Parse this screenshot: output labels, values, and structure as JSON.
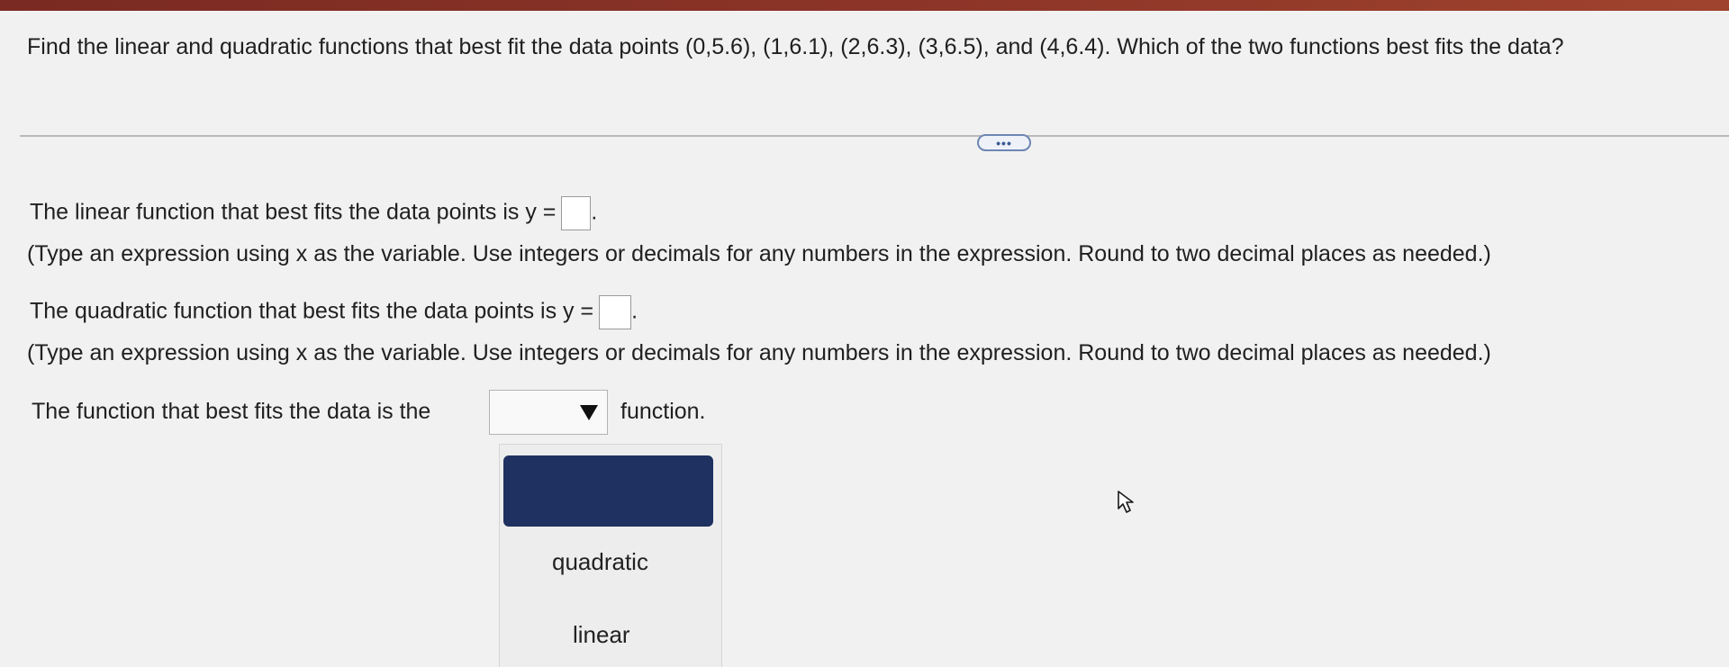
{
  "question": {
    "text": "Find the linear and quadratic functions that best fit the data points (0,5.6), (1,6.1), (2,6.3), (3,6.5), and (4,6.4). Which of the two functions best fits the data?"
  },
  "more_button": {
    "label": "•••"
  },
  "linear": {
    "prompt": "The linear function that best fits the data points is y =",
    "end": ".",
    "instruction": "(Type an expression using x as the variable. Use integers or decimals for any numbers in the expression. Round to two decimal places as needed.)",
    "value": ""
  },
  "quadratic": {
    "prompt": "The quadratic function that best fits the data points is y =",
    "end": ".",
    "instruction": "(Type an expression using x as the variable. Use integers or decimals for any numbers in the expression. Round to two decimal places as needed.)",
    "value": ""
  },
  "best_fit": {
    "prefix": "The function that best fits the data is the",
    "suffix": "function.",
    "selected": "",
    "options": [
      "",
      "quadratic",
      "linear"
    ]
  },
  "colors": {
    "top_bar": "#8d3528",
    "selected_option": "#1f3160",
    "more_button_border": "#6d86b3"
  }
}
